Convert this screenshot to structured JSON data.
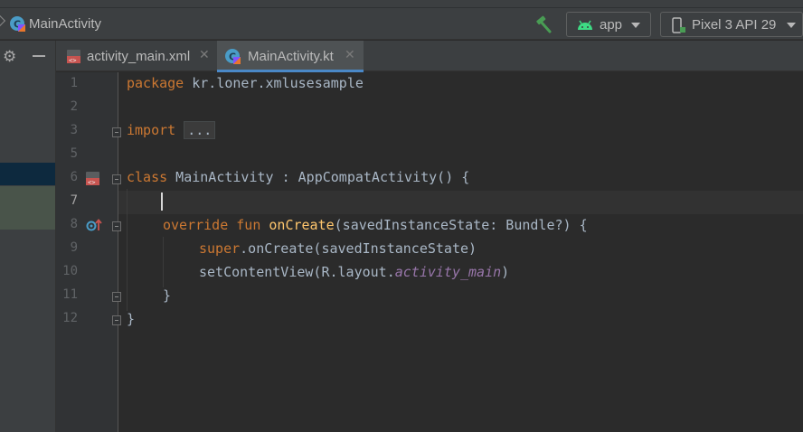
{
  "header": {
    "title": "MainActivity",
    "run_config": "app",
    "device": "Pixel 3 API 29"
  },
  "tabs": [
    {
      "label": "activity_main.xml",
      "active": false,
      "icon": "xml-layout-icon"
    },
    {
      "label": "MainActivity.kt",
      "active": true,
      "icon": "kotlin-class-icon"
    }
  ],
  "editor": {
    "current_line": 7,
    "line_numbers": [
      "1",
      "2",
      "3",
      "5",
      "6",
      "7",
      "8",
      "9",
      "10",
      "11",
      "12"
    ],
    "lines": {
      "l1": {
        "kw": "package",
        "rest": " kr.loner.xmlusesample"
      },
      "l3": {
        "kw": "import",
        "folded": "..."
      },
      "l6": {
        "kw": "class",
        "rest": " MainActivity : AppCompatActivity() {"
      },
      "l8": {
        "kw1": "override",
        "kw2": "fun",
        "fn": "onCreate",
        "rest": "(savedInstanceState: Bundle?) {"
      },
      "l9": {
        "kw": "super",
        "rest": ".onCreate(savedInstanceState)"
      },
      "l10": {
        "pre": "setContentView(R.layout.",
        "field": "activity_main",
        "post": ")"
      },
      "l11": {
        "text": "}"
      },
      "l12": {
        "text": "}"
      }
    }
  },
  "colors": {
    "background": "#2b2b2b",
    "keyword": "#cc7832",
    "function": "#ffc66d",
    "field": "#9876aa",
    "text": "#a9b7c6",
    "tab_underline": "#4a88c7",
    "run_icon": "#499c54"
  }
}
